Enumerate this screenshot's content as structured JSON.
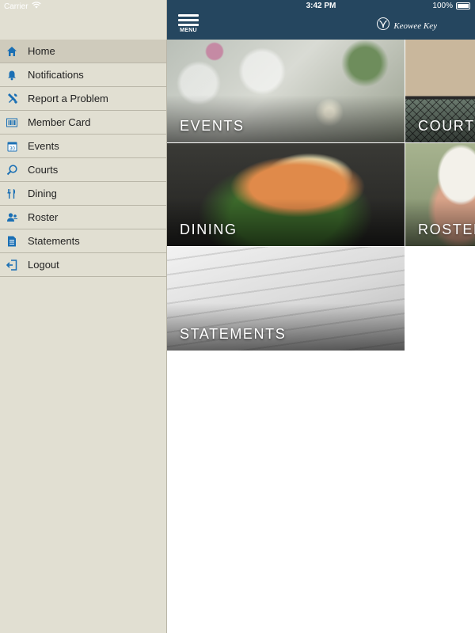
{
  "status": {
    "carrier": "Carrier",
    "time": "3:42 PM",
    "battery": "100%"
  },
  "colors": {
    "sidebar_bg": "#e1dfd2",
    "topbar_bg": "#25465f",
    "icon_blue": "#1a6fb4"
  },
  "header": {
    "menu_label": "MENU",
    "logo_text": "Keowee Key"
  },
  "sidebar": {
    "items": [
      {
        "label": "Home",
        "icon": "home-icon"
      },
      {
        "label": "Notifications",
        "icon": "bell-icon"
      },
      {
        "label": "Report a Problem",
        "icon": "tools-icon"
      },
      {
        "label": "Member Card",
        "icon": "barcode-icon"
      },
      {
        "label": "Events",
        "icon": "calendar-icon"
      },
      {
        "label": "Courts",
        "icon": "racket-icon"
      },
      {
        "label": "Dining",
        "icon": "utensils-icon"
      },
      {
        "label": "Roster",
        "icon": "people-icon"
      },
      {
        "label": "Statements",
        "icon": "document-icon"
      },
      {
        "label": "Logout",
        "icon": "logout-icon"
      }
    ],
    "active_index": 0
  },
  "tiles": {
    "events": "EVENTS",
    "courts": "COURTS",
    "dining": "DINING",
    "roster": "ROSTER",
    "statements": "STATEMENTS"
  }
}
